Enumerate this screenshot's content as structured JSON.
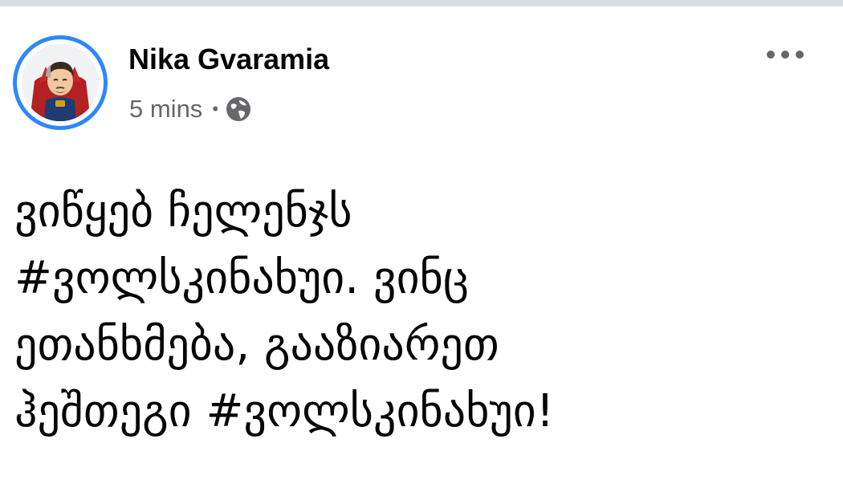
{
  "post": {
    "author": "Nika Gvaramia",
    "time": "5 mins",
    "separator": "•",
    "privacy_icon": "globe-icon",
    "more_icon": "more-options-icon",
    "avatar_icon": "avatar",
    "text_lines": [
      "ვიწყებ ჩელენჯს",
      "#ვოლსკინახუი. ვინც",
      "ეთანხმება, გააზიარეთ",
      "ჰეშთეგი #ვოლსკინახუი!"
    ]
  },
  "colors": {
    "avatar_ring": "#2d88ff",
    "meta_text": "#65676b",
    "primary_text": "#050505",
    "top_strip": "#dadde1"
  }
}
